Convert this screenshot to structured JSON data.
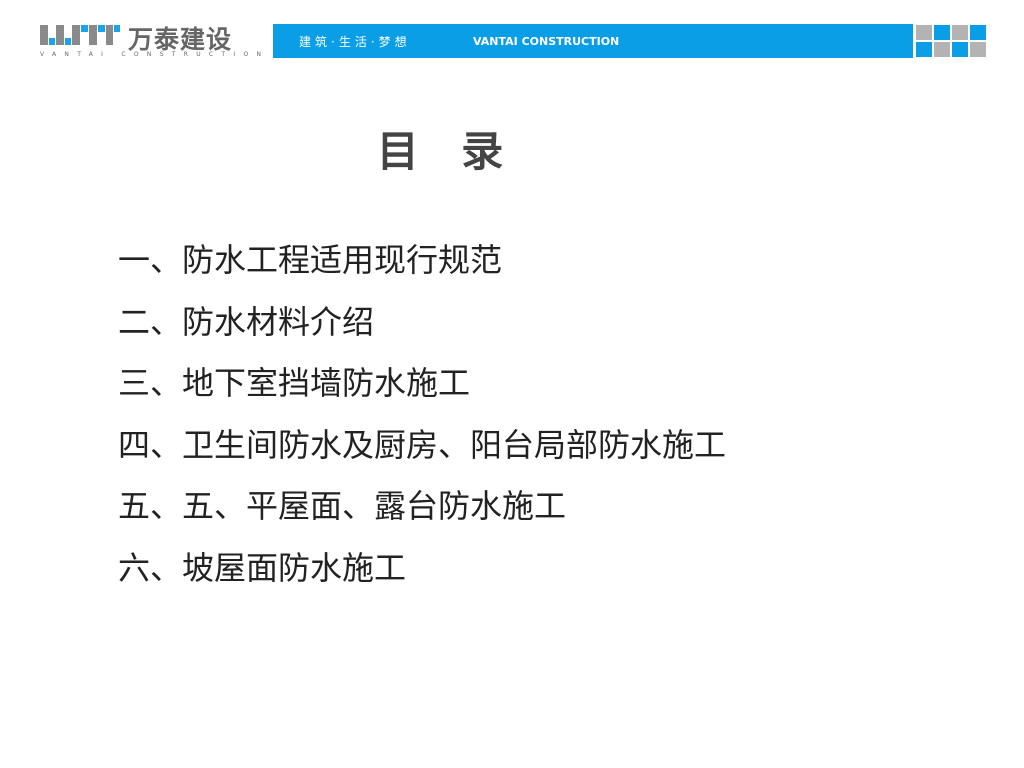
{
  "header": {
    "logo_text": "万泰建设",
    "logo_subtitle": "VANTAI CONSTRUCTION",
    "slogan": "建筑·生活·梦想",
    "brand": "VANTAI CONSTRUCTION",
    "colors": {
      "blue": "#0a9ee6",
      "gray": "#b3b3b3"
    }
  },
  "title": "目 录",
  "items": [
    "一、防水工程适用现行规范",
    "二、防水材料介绍",
    "三、地下室挡墙防水施工",
    "四、卫生间防水及厨房、阳台局部防水施工",
    "五、五、平屋面、露台防水施工",
    "六、坡屋面防水施工"
  ]
}
